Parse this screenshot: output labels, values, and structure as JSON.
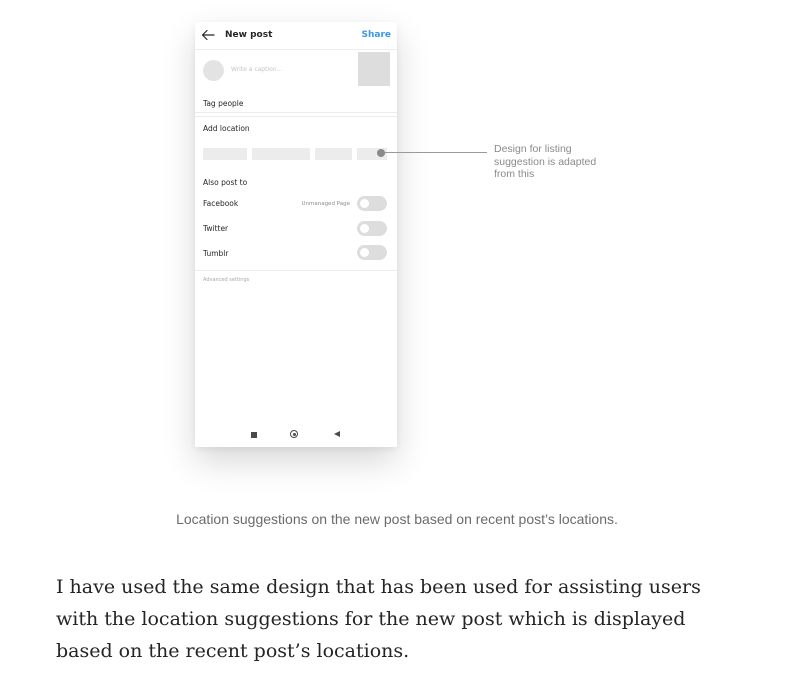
{
  "mockup": {
    "header": {
      "back_icon": "arrow-left-icon",
      "title": "New post",
      "share_label": "Share"
    },
    "caption": {
      "placeholder": "Write a caption..."
    },
    "rows": {
      "tag_people": "Tag people",
      "add_location": "Add location"
    },
    "location_suggestions_count": 4,
    "also_post_to": {
      "heading": "Also post to",
      "items": [
        {
          "label": "Facebook",
          "note": "Unmanaged Page",
          "enabled": false
        },
        {
          "label": "Twitter",
          "enabled": false
        },
        {
          "label": "Tumblr",
          "enabled": false
        }
      ]
    },
    "advanced_settings": "Advanced settings",
    "nav_bar": {
      "icons": [
        "square-icon",
        "home-circle-icon",
        "back-triangle-icon"
      ]
    }
  },
  "callout": {
    "text": "Design for listing suggestion is adapted from this"
  },
  "figure_caption": "Location suggestions on the new post based on recent post’s locations.",
  "body_paragraph": "I have used the same design that has been used for assisting users with the location suggestions for the new post which is displayed based on the recent post’s locations.",
  "colors": {
    "accent": "#3897f0",
    "text": "#242424",
    "muted": "#6b6b6b"
  }
}
